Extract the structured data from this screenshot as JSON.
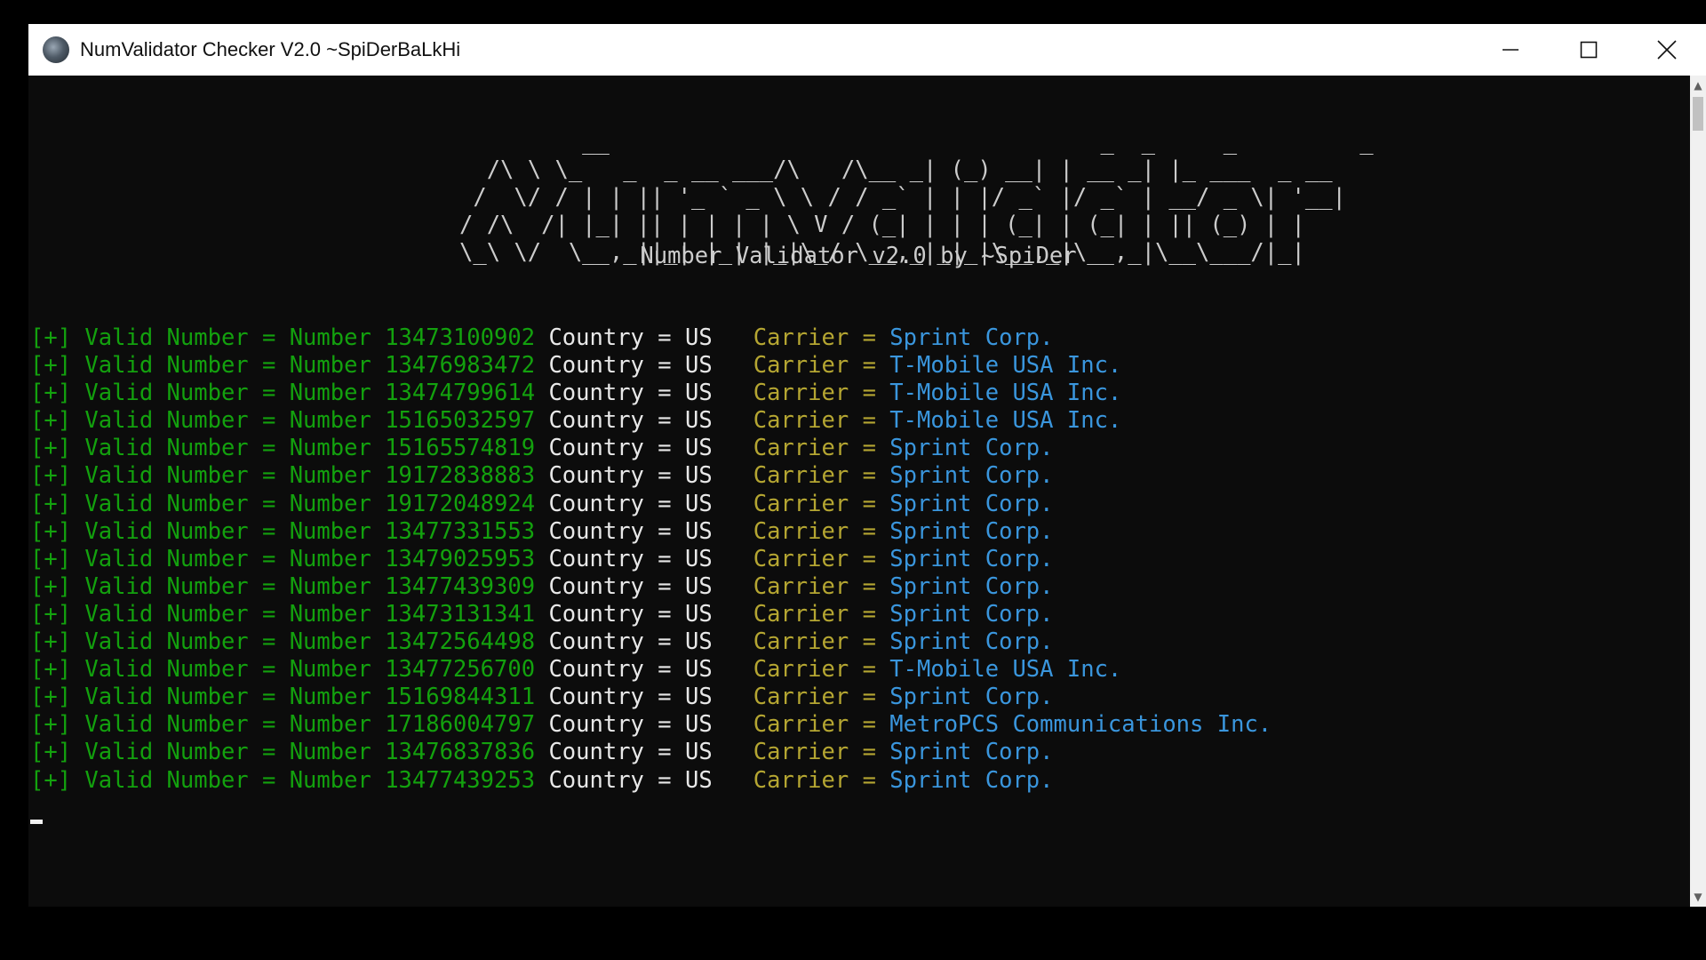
{
  "window": {
    "title": "NumValidator Checker V2.0 ~SpiDerBaLkHi",
    "icon": "spider-app-icon",
    "controls": [
      "minimize-icon",
      "maximize-icon",
      "close-icon"
    ]
  },
  "console": {
    "banner": "         __                                    _  _     _         _\n  /\\ \\ \\_   _  _ __ ___/\\   /\\__ _| (_) __| | __ _| |_ ___  _ __\n /  \\/ / | | || '_ ` _ \\ \\ / / _` | | |/ _` |/ _` | __/ _ \\| '__|\n/ /\\  /| |_| || | | | | \\ V / (_| | | | (_| | (_| | || (_) | |\n\\_\\ \\/  \\__,_||_| |_| |_|\\_/ \\__,_|_|_|\\__,_|\\__,_|\\__\\___/|_|",
    "subtitle": "Number Validator v2.0 by ~SpiDer",
    "prefix": "[+]",
    "valid_label": "Valid Number = Number",
    "country_label": "Country =",
    "carrier_label": "Carrier =",
    "colors": {
      "background": "#0c0c0c",
      "valid": "#13a10e",
      "country": "#e8e8e8",
      "carrier_label": "#b5a632",
      "carrier_value": "#3a96dd"
    },
    "rows": [
      {
        "number": "13473100902",
        "country": "US",
        "carrier": "Sprint Corp."
      },
      {
        "number": "13476983472",
        "country": "US",
        "carrier": "T-Mobile USA Inc."
      },
      {
        "number": "13474799614",
        "country": "US",
        "carrier": "T-Mobile USA Inc."
      },
      {
        "number": "15165032597",
        "country": "US",
        "carrier": "T-Mobile USA Inc."
      },
      {
        "number": "15165574819",
        "country": "US",
        "carrier": "Sprint Corp."
      },
      {
        "number": "19172838883",
        "country": "US",
        "carrier": "Sprint Corp."
      },
      {
        "number": "19172048924",
        "country": "US",
        "carrier": "Sprint Corp."
      },
      {
        "number": "13477331553",
        "country": "US",
        "carrier": "Sprint Corp."
      },
      {
        "number": "13479025953",
        "country": "US",
        "carrier": "Sprint Corp."
      },
      {
        "number": "13477439309",
        "country": "US",
        "carrier": "Sprint Corp."
      },
      {
        "number": "13473131341",
        "country": "US",
        "carrier": "Sprint Corp."
      },
      {
        "number": "13472564498",
        "country": "US",
        "carrier": "Sprint Corp."
      },
      {
        "number": "13477256700",
        "country": "US",
        "carrier": "T-Mobile USA Inc."
      },
      {
        "number": "15169844311",
        "country": "US",
        "carrier": "Sprint Corp."
      },
      {
        "number": "17186004797",
        "country": "US",
        "carrier": "MetroPCS Communications Inc."
      },
      {
        "number": "13476837836",
        "country": "US",
        "carrier": "Sprint Corp."
      },
      {
        "number": "13477439253",
        "country": "US",
        "carrier": "Sprint Corp."
      }
    ]
  },
  "scrollbar": {
    "up_icon": "scroll-up-arrow-icon",
    "down_icon": "scroll-down-arrow-icon"
  }
}
